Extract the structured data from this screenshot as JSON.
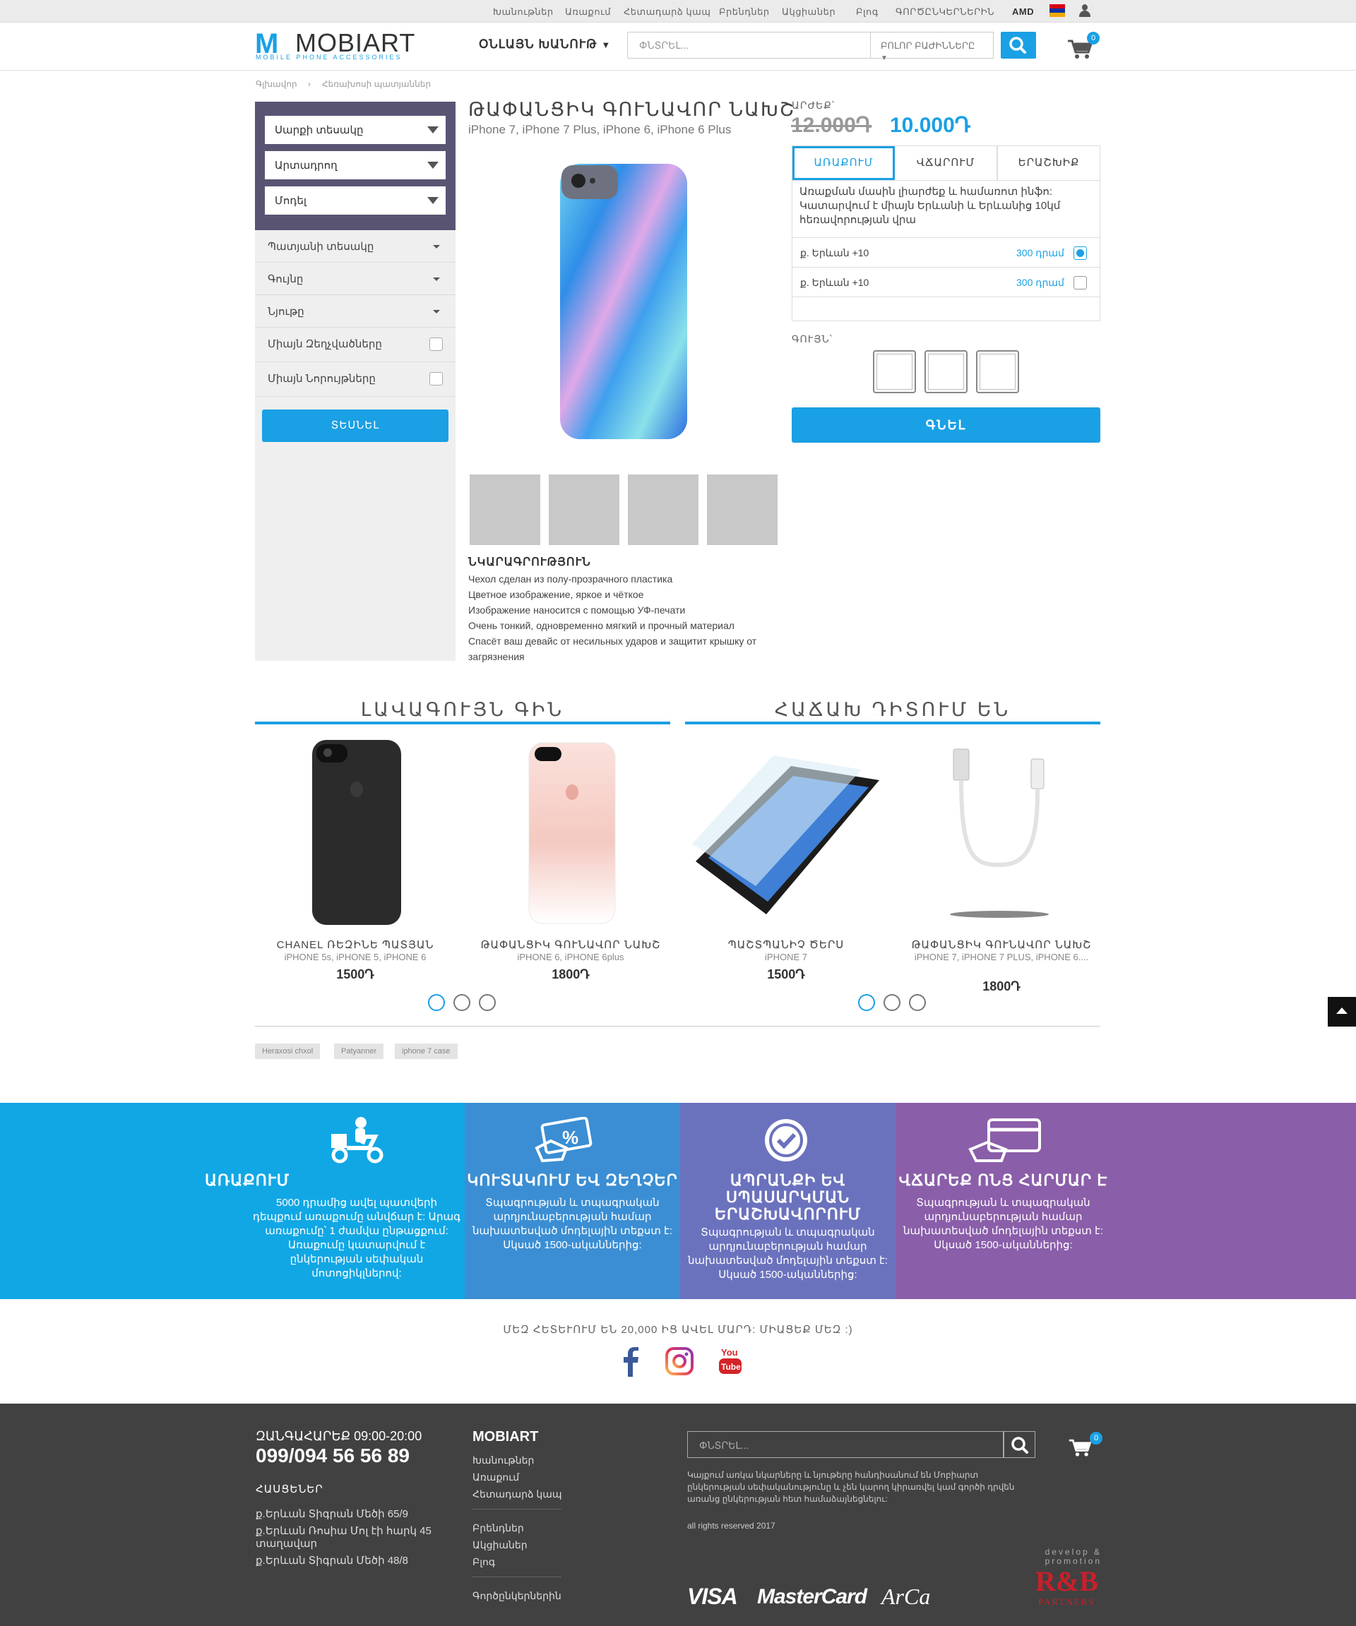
{
  "topbar": {
    "links": [
      "Խանութներ",
      "Առաքում",
      "Հետադարձ կապ",
      "Բրենդներ",
      "Ակցիաներ",
      "Բլոգ",
      "ԳՈՐԾԸՆԿԵՐՆԵՐԻՆ"
    ],
    "currency": "AMD"
  },
  "header": {
    "logo": "MOBIART",
    "logo_sub": "MOBILE PHONE ACCESSORIES",
    "shop_label": "ՕՆԼԱՅՆ ԽԱՆՈՒԹ",
    "search_placeholder": "ՓՆՏՐԵԼ...",
    "category_label": "ԲՈԼՈՐ ԲԱԺԻՆՆԵՐԸ",
    "cart_count": "0"
  },
  "breadcrumb": [
    "Գլխավոր",
    "Հեռախոսի պատյաններ"
  ],
  "sidebar": {
    "dropdowns": [
      "Սարքի տեսակը",
      "Արտադրող",
      "Մոդել"
    ],
    "filters": [
      "Պատյանի տեսակը",
      "Գույնը",
      "Նյութը"
    ],
    "checks": [
      "Միայն Զեղչվածները",
      "Միայն Նորույթները"
    ],
    "button": "ՏԵՍՆԵԼ"
  },
  "product": {
    "title": "ԹԱՓԱՆՑԻԿ ԳՈՒՆԱՎՈՐ ՆԱԽՇ",
    "models": "iPhone 7, iPhone 7 Plus, iPhone 6, iPhone 6 Plus",
    "desc_title": "ՆԿԱՐԱԳՐՈՒԹՅՈՒՆ",
    "desc": [
      "Чехол сделан из полу-прозрачного пластика",
      "Цветное изображение, яркое и чёткое",
      "Изображение наносится с помощью УФ-печати",
      "Очень тонкий, одновременно мягкий и прочный материал",
      "Спасёт ваш девайс от несильных ударов и защитит крышку от",
      "загрязнения"
    ]
  },
  "price": {
    "label": "ԱՐԺԵՔ՝",
    "old": "12.000Դ",
    "new": "10.000Դ"
  },
  "tabs": [
    "ԱՌԱՔՈՒՄ",
    "ՎՃԱՐՈՒՄ",
    "ԵՐԱՇԽԻՔ"
  ],
  "delivery": {
    "text": "Առաքման մասին լիարժեք և համառոտ ինֆո: Կատարվում է միայն Երևանի և Երևանից 10կմ հեռավորության վրա",
    "rows": [
      {
        "label": "ք. Երևան +10",
        "price": "300 դրամ"
      },
      {
        "label": "ք. Երևան +10",
        "price": "300 դրամ"
      }
    ]
  },
  "color_label": "ԳՈՒՅՆ՝",
  "buy": "ԳՆԵԼ",
  "sections": {
    "best": "ԼԱՎԱԳՈՒՅՆ ԳԻՆ",
    "popular": "ՀԱՃԱԽ ԴԻՏՈՒՄ ԵՆ"
  },
  "products": [
    {
      "name": "CHANEL ՌԵԶԻՆԵ ՊԱՏՅԱՆ",
      "models": "iPHONE 5s, iPHONE 5, iPHONE 6",
      "price": "1500Դ"
    },
    {
      "name": "ԹԱՓԱՆՑԻԿ ԳՈՒՆԱՎՈՐ ՆԱԽՇ",
      "models": "iPHONE 6, iPHONE 6plus",
      "price": "1800Դ"
    },
    {
      "name": "ՊԱՇՏՊԱՆԻՉ ԾԵՐՍ",
      "models": "iPHONE 7",
      "price": "1500Դ"
    },
    {
      "name": "ԹԱՓԱՆՑԻԿ ԳՈՒՆԱՎՈՐ ՆԱԽՇ",
      "models": "iPHONE 7, iPHONE 7 PLUS, iPHONE 6....",
      "price": "1800Դ"
    }
  ],
  "tags": [
    "Heraxosi chxol",
    "Patyanner",
    "iphone 7 case"
  ],
  "features": [
    {
      "title": "ԱՌԱՔՈՒՄ",
      "text": [
        "5000 դրամից ավել պատվերի",
        "դեպքում առաքումը անվճար է: Արագ",
        "առաքումը՝ 1 ժամվա ընթացքում:",
        "Առաքումը կատարվում է",
        "ընկերության սեփական",
        "մոտոցիկլներով:"
      ],
      "color": "#11a7e5"
    },
    {
      "title": "ԿՈՒՏԱԿՈՒՄ ԵՎ ԶԵՂՉԵՐ",
      "text": [
        "Տպագրության և տպագրական",
        "արդյունաբերության համար",
        "նախատեսված մոդելային տեքստ է:",
        "Սկսած 1500-ականներից:"
      ],
      "color": "#3b8ed3"
    },
    {
      "title": "ԱՊՐԱՆՔԻ ԵՎ ՍՊԱՍԱՐԿՄԱՆ ԵՐԱՇԽԱՎՈՐՈՒՄ",
      "text": [
        "Տպագրության և տպագրական",
        "արդյունաբերության համար",
        "նախատեսված մոդելային տեքստ է:",
        "Սկսած 1500-ականներից:"
      ],
      "color": "#6b72bd"
    },
    {
      "title": "ՎՃԱՐԵՔ ՈՆՑ ՀԱՐՄԱՐ Է",
      "text": [
        "Տպագրության և տպագրական",
        "արդյունաբերության համար",
        "նախատեսված մոդելային տեքստ է:",
        "Սկսած 1500-ականներից:"
      ],
      "color": "#8a5ea9"
    }
  ],
  "social": {
    "text": "ՄԵԶ ՀԵՏԵՒՈՒՄ ԵՆ 20,000 ԻՑ ԱՎԵԼ ՄԱՐԴ: ՄԻԱՑԵՔ ՄԵԶ :)"
  },
  "footer": {
    "call": "ԶԱՆԳԱՀԱՐԵՔ 09:00-20:00",
    "phone": "099/094 56 56 89",
    "addr_title": "ՀԱՍՑԵՆԵՐ",
    "addrs": [
      "ք.Երևան Տիգրան Մեծի 65/9",
      "ք.Երևան Ռոսիա Մոլ էի հարկ 45",
      "տաղավար",
      "ք.Երևան Տիգրան Մեծի 48/8"
    ],
    "brand": "MOBIART",
    "links1": [
      "Խանութներ",
      "Առաքում",
      "Հետադարձ կապ"
    ],
    "links2": [
      "Բրենդներ",
      "Ակցիաներ",
      "Բլոգ"
    ],
    "links3": [
      "Գործընկերներին"
    ],
    "search_placeholder": "ՓՆՏՐԵԼ...",
    "legal": [
      "Կայքում առկա նկարները և նյութերը հանդիսանում են Մոբիարտ",
      "ընկերության սեփականությունը և չեն կարող կիրառվել կամ գործի դրվեն",
      "առանց ընկերության հետ համաձայնեցնելու:"
    ],
    "rights": "all rights reserved 2017",
    "payments": [
      "VISA",
      "MasterCard",
      "ArCa"
    ],
    "dev": [
      "develop &",
      "promotion"
    ],
    "dev_brand": "R&B",
    "dev_sub": "PARTNERS",
    "cart_count": "0"
  }
}
